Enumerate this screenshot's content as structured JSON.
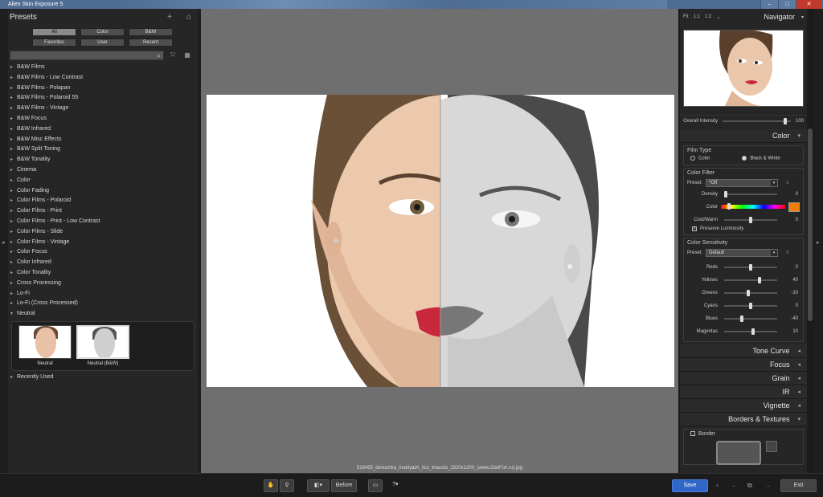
{
  "window": {
    "title": "Alien Skin Exposure 5",
    "min": "–",
    "max": "□",
    "close": "✕"
  },
  "left_panel": {
    "title": "Presets",
    "add_icon": "+",
    "home_icon": "⌂",
    "filters": [
      "All",
      "Color",
      "B&W",
      "Favorites",
      "User",
      "Recent"
    ],
    "active_filter": "All",
    "search": {
      "value": "",
      "placeholder": ""
    },
    "presets": [
      "B&W Films",
      "B&W Films - Low Contrast",
      "B&W Films - Polapan",
      "B&W Films - Polaroid 55",
      "B&W Films - Vintage",
      "B&W Focus",
      "B&W Infrared",
      "B&W Misc Effects",
      "B&W Split Toning",
      "B&W Tonality",
      "Cinema",
      "Color",
      "Color Fading",
      "Color Films - Polaroid",
      "Color Films - Print",
      "Color Films - Print - Low Contrast",
      "Color Films - Slide",
      "Color Films - Vintage",
      "Color Focus",
      "Color Infrared",
      "Color Tonality",
      "Cross Processing",
      "Lo-Fi",
      "Lo-Fi (Cross Processed)"
    ],
    "open_group": "Neutral",
    "thumbnails": [
      {
        "label": "Neutral"
      },
      {
        "label": "Neutral (B&W)"
      }
    ],
    "after_group": "Recently Used"
  },
  "canvas": {
    "filename": "516455_devushka_makiyazh_lico_krasota_1920x1200_(www.GdeFon.ru).jpg"
  },
  "navigator": {
    "zoom_fit": "Fit",
    "zoom_1": "1:1",
    "zoom_2": "1:2",
    "title": "Navigator"
  },
  "intensity": {
    "label": "Overall Intensity",
    "value": "100",
    "level": 0.9
  },
  "color_section": {
    "title": "Color",
    "film_type": {
      "label": "Film Type",
      "options": [
        "Color",
        "Black & White"
      ],
      "selected": "Black & White"
    },
    "color_filter": {
      "label": "Color Filter",
      "preset_label": "Preset:",
      "preset_value": "*Off",
      "density_label": "Density",
      "density_value": "0",
      "color_label": "Color",
      "color_swatch": "#f07c0a",
      "coolwarm_label": "Cool/Warm",
      "coolwarm_value": "0",
      "preserve_label": "Preserve Luminosity"
    },
    "sensitivity": {
      "label": "Color Sensitivity",
      "preset_label": "Preset:",
      "preset_value": "Default",
      "sliders": [
        {
          "name": "Reds",
          "value": "0",
          "level": 0.5
        },
        {
          "name": "Yellows",
          "value": "40",
          "level": 0.68
        },
        {
          "name": "Greens",
          "value": "-10",
          "level": 0.45
        },
        {
          "name": "Cyans",
          "value": "0",
          "level": 0.5
        },
        {
          "name": "Blues",
          "value": "-40",
          "level": 0.32
        },
        {
          "name": "Magentas",
          "value": "10",
          "level": 0.55
        }
      ]
    }
  },
  "sections": [
    "Tone Curve",
    "Focus",
    "Grain",
    "IR",
    "Vignette",
    "Borders & Textures"
  ],
  "border": {
    "label": "Border"
  },
  "bottom": {
    "before_label": "Before",
    "save_label": "Save",
    "exit_label": "Exit"
  }
}
